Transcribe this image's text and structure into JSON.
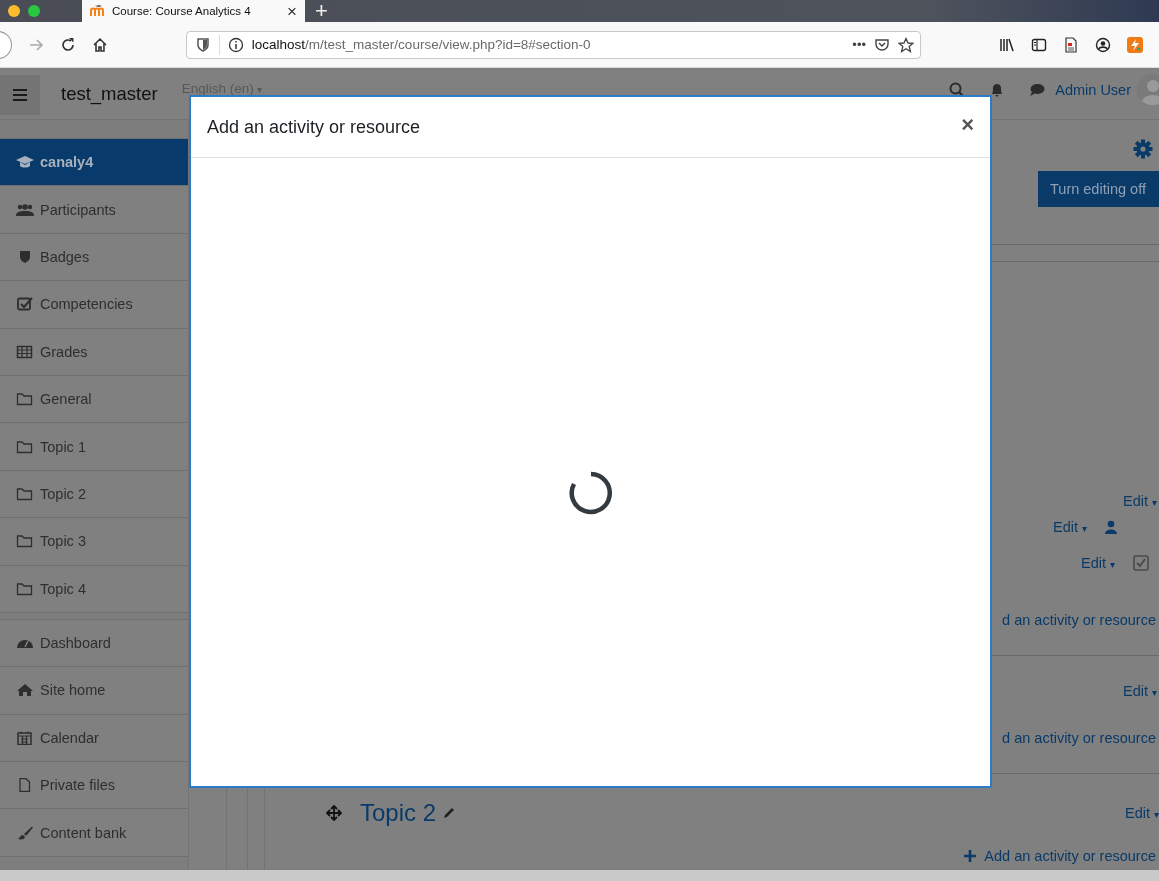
{
  "browser": {
    "tab": {
      "title": "Course: Course Analytics 4",
      "close": "×"
    },
    "new_tab": "+",
    "url": {
      "host": "localhost",
      "path": "/m/test_master/course/view.php?id=8#section-0"
    },
    "page_actions": "•••"
  },
  "header": {
    "site_name": "test_master",
    "language": "English (en)",
    "language_caret": "▾",
    "user": "Admin User"
  },
  "sidebar": {
    "course_items": [
      {
        "label": "canaly4",
        "selected": true
      },
      {
        "label": "Participants",
        "selected": false
      },
      {
        "label": "Badges",
        "selected": false
      },
      {
        "label": "Competencies",
        "selected": false
      },
      {
        "label": "Grades",
        "selected": false
      },
      {
        "label": "General",
        "selected": false
      },
      {
        "label": "Topic 1",
        "selected": false
      },
      {
        "label": "Topic 2",
        "selected": false
      },
      {
        "label": "Topic 3",
        "selected": false
      },
      {
        "label": "Topic 4",
        "selected": false
      }
    ],
    "site_items": [
      {
        "label": "Dashboard",
        "selected": false
      },
      {
        "label": "Site home",
        "selected": false
      },
      {
        "label": "Calendar",
        "selected": false
      },
      {
        "label": "Private files",
        "selected": false
      },
      {
        "label": "Content bank",
        "selected": false
      }
    ]
  },
  "main": {
    "edit_mode_button": "Turn editing off",
    "sections": [
      {
        "edits": [
          {
            "kind": "plain",
            "label": "Edit",
            "caret": "▾"
          },
          {
            "kind": "user",
            "label": "Edit",
            "caret": "▾"
          },
          {
            "kind": "completion",
            "label": "Edit",
            "caret": "▾",
            "checked": true
          }
        ],
        "add_link": "d an activity or resource"
      },
      {
        "edits": [
          {
            "kind": "plain",
            "label": "Edit",
            "caret": "▾"
          }
        ],
        "add_link": "d an activity or resource"
      },
      {
        "title": "Topic 2",
        "edits": [
          {
            "kind": "plain",
            "label": "Edit",
            "caret": "▾"
          }
        ],
        "add_link": "Add an activity or resource"
      }
    ]
  },
  "modal": {
    "title": "Add an activity or resource",
    "close": "×",
    "loading": true
  }
}
